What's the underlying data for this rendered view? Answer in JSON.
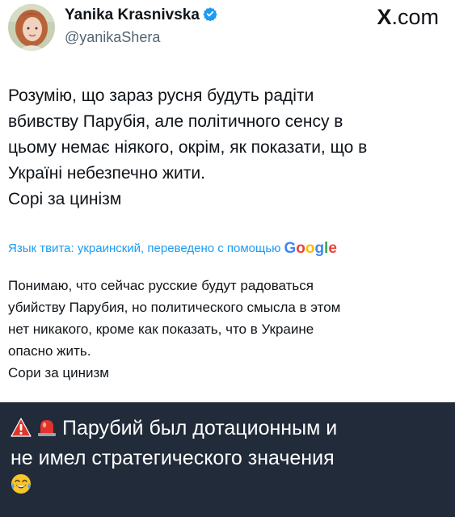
{
  "tweet": {
    "author_name": "Yanika Krasnivska",
    "handle": "@yanikaShera",
    "brand": {
      "x": "X",
      "suffix": ".com"
    },
    "text_lines": [
      "Розумію, що зараз русня будуть радіти",
      "вбивству Парубія, але політичного сенсу в",
      "цьому немає ніякого, окрім, як показати, що в",
      "Україні небезпечно жити.",
      "Сорі за цинізм"
    ],
    "translate_note": "Язык твита: украинский, переведено с помощью",
    "translate_brand": "Google",
    "translation_lines": [
      "Понимаю, что сейчас русские будут радоваться",
      "убийству Парубия, но политического смысла в этом",
      "нет никакого, кроме как показать, что в Украине",
      "опасно жить.",
      "Сори за цинизм"
    ],
    "icons": {
      "verified": "verified-badge-icon"
    },
    "colors": {
      "verified": "#1d9bf0",
      "translate_link": "#1d9bf0"
    }
  },
  "caption": {
    "line1": "Парубий был дотационным и",
    "line2": "не имел стратегического значения",
    "icons": [
      "warning-icon",
      "siren-icon",
      "laughing-tears-icon"
    ],
    "background": "#212b39"
  }
}
